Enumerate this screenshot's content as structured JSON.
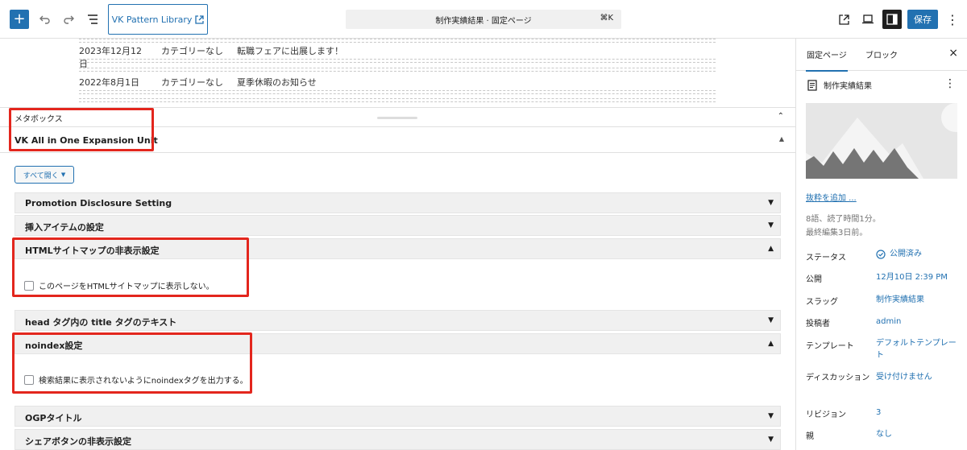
{
  "toolbar": {
    "add_label": "+",
    "pattern_library_label": "VK Pattern Library",
    "doc_title": "制作実績結果 · 固定ページ",
    "shortcut": "⌘K",
    "save_label": "保存"
  },
  "content": {
    "news": [
      {
        "date": "2023年12月12日",
        "category": "カテゴリーなし",
        "title": "転職フェアに出展します！"
      },
      {
        "date": "2022年8月1日",
        "category": "カテゴリーなし",
        "title": "夏季休暇のお知らせ"
      }
    ]
  },
  "metabox": {
    "label": "メタボックス",
    "unit_title": "VK All in One Expansion Unit",
    "expand_all": "すべて開く",
    "sections": [
      {
        "title": "Promotion Disclosure Setting",
        "open": false
      },
      {
        "title": "挿入アイテムの設定",
        "open": false
      },
      {
        "title": "HTMLサイトマップの非表示設定",
        "open": true,
        "checkbox": "このページをHTMLサイトマップに表示しない。"
      },
      {
        "title": "head タグ内の title タグのテキスト",
        "open": false
      },
      {
        "title": "noindex設定",
        "open": true,
        "checkbox": "検索結果に表示されないようにnoindexタグを出力する。"
      },
      {
        "title": "OGPタイトル",
        "open": false
      },
      {
        "title": "シェアボタンの非表示設定",
        "open": false
      }
    ]
  },
  "sidebar": {
    "tab_page": "固定ページ",
    "tab_block": "ブロック",
    "close": "×",
    "doc_name": "制作実績結果",
    "add_excerpt": "抜粋を追加 ...",
    "stats": "8語、読了時間1分。",
    "last_edited": "最終編集3日前。",
    "rows": [
      {
        "label": "ステータス",
        "value": "公開済み"
      },
      {
        "label": "公開",
        "value": "12月10日 2:39 PM"
      },
      {
        "label": "スラッグ",
        "value": "制作実績結果"
      },
      {
        "label": "投稿者",
        "value": "admin"
      },
      {
        "label": "テンプレート",
        "value": "デフォルトテンプレート"
      },
      {
        "label": "ディスカッション",
        "value": "受け付けません"
      },
      {
        "label": "リビジョン",
        "value": "3"
      },
      {
        "label": "親",
        "value": "なし"
      }
    ]
  },
  "colors": {
    "accent": "#2271b1",
    "highlight": "#e3261d"
  }
}
